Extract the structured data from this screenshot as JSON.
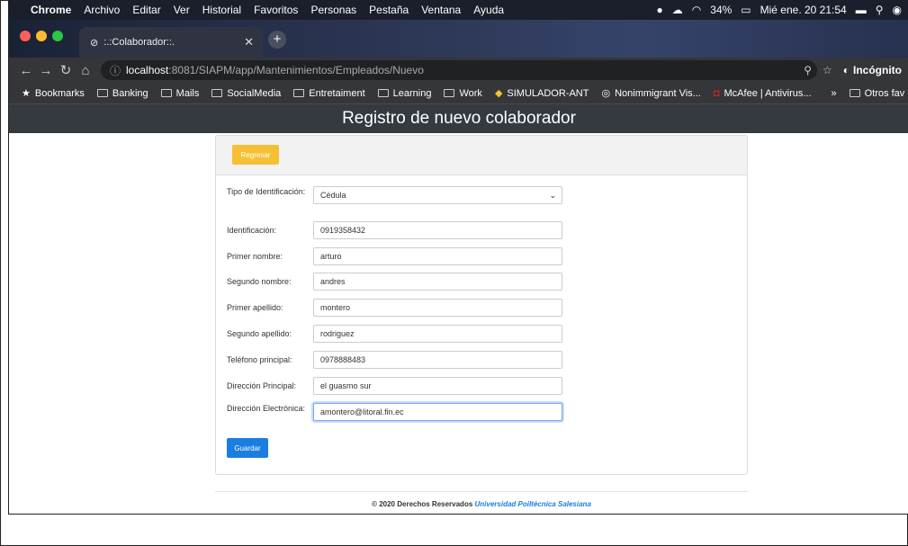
{
  "menubar": {
    "app": "Chrome",
    "items": [
      "Archivo",
      "Editar",
      "Ver",
      "Historial",
      "Favoritos",
      "Personas",
      "Pestaña",
      "Ventana",
      "Ayuda"
    ],
    "battery": "34%",
    "datetime": "Mié ene. 20  21:54"
  },
  "tab": {
    "title": ":.:Colaborador::."
  },
  "address": {
    "host": "localhost",
    "path": ":8081/SIAPM/app/Mantenimientos/Empleados/Nuevo",
    "incognito": "Incógnito"
  },
  "bookmarks": [
    {
      "label": "Bookmarks",
      "icon": "star-icon"
    },
    {
      "label": "Banking",
      "icon": "folder-icon"
    },
    {
      "label": "Mails",
      "icon": "folder-icon"
    },
    {
      "label": "SocialMedia",
      "icon": "folder-icon"
    },
    {
      "label": "Entretaiment",
      "icon": "folder-icon"
    },
    {
      "label": "Learning",
      "icon": "folder-icon"
    },
    {
      "label": "Work",
      "icon": "folder-icon"
    },
    {
      "label": "SIMULADOR-ANT",
      "icon": "site-icon"
    },
    {
      "label": "Nonimmigrant Vis...",
      "icon": "site-icon"
    },
    {
      "label": "McAfee | Antivirus...",
      "icon": "mcafee-icon"
    },
    {
      "label": "Otros fav",
      "icon": "folder-icon"
    }
  ],
  "page": {
    "title": "Registro de nuevo colaborador",
    "back_label": "Regresar",
    "save_label": "Guardar"
  },
  "form": {
    "tipo": {
      "label": "Tipo de Identificación:",
      "value": "Cédula"
    },
    "fields": [
      {
        "label": "Identificación:",
        "value": "0919358432"
      },
      {
        "label": "Primer nombre:",
        "value": "arturo"
      },
      {
        "label": "Segundo nombre:",
        "value": "andres"
      },
      {
        "label": "Primer apellido:",
        "value": "montero"
      },
      {
        "label": "Segundo apellido:",
        "value": "rodriguez"
      },
      {
        "label": "Teléfono principal:",
        "value": "0978888483"
      },
      {
        "label": "Dirección Principal:",
        "value": "el guasmo sur"
      },
      {
        "label": "Dirección Electrónica:",
        "value": "amontero@litoral.fin.ec"
      }
    ]
  },
  "footer": {
    "text": "© 2020 Derechos Reservados ",
    "university": "Universidad Poiltécnica Salesiana"
  },
  "colors": {
    "header_bg": "#343a40",
    "back_btn": "#f6c035",
    "save_btn": "#1a7ee0"
  }
}
